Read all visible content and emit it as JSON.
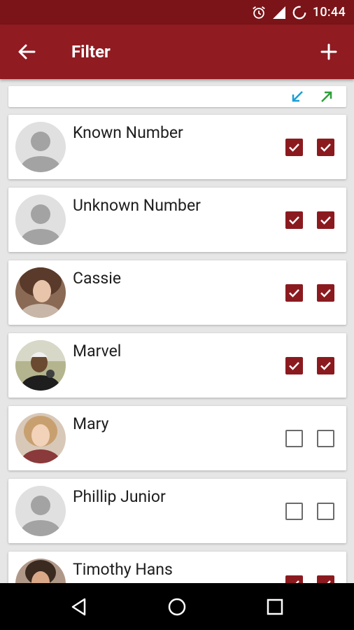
{
  "status_bar": {
    "time": "10:44"
  },
  "app_bar": {
    "title": "Filter"
  },
  "colors": {
    "primary": "#901b21",
    "status_bar": "#7a1418",
    "checkbox_checked": "#8b1a1f",
    "incoming_arrow": "#1a9fd8",
    "outgoing_arrow": "#2ea03a"
  },
  "header": {
    "icons": [
      "incoming-call-arrow-icon",
      "outgoing-call-arrow-icon"
    ]
  },
  "contacts": [
    {
      "name": "Known Number",
      "avatar": "default-avatar",
      "incoming": true,
      "outgoing": true
    },
    {
      "name": "Unknown Number",
      "avatar": "default-avatar",
      "incoming": true,
      "outgoing": true
    },
    {
      "name": "Cassie",
      "avatar": "photo",
      "incoming": true,
      "outgoing": true
    },
    {
      "name": "Marvel",
      "avatar": "photo",
      "incoming": true,
      "outgoing": true
    },
    {
      "name": "Mary",
      "avatar": "photo",
      "incoming": false,
      "outgoing": false
    },
    {
      "name": "Phillip Junior",
      "avatar": "default-avatar",
      "incoming": false,
      "outgoing": false
    },
    {
      "name": "Timothy Hans",
      "avatar": "photo",
      "incoming": true,
      "outgoing": true
    }
  ]
}
